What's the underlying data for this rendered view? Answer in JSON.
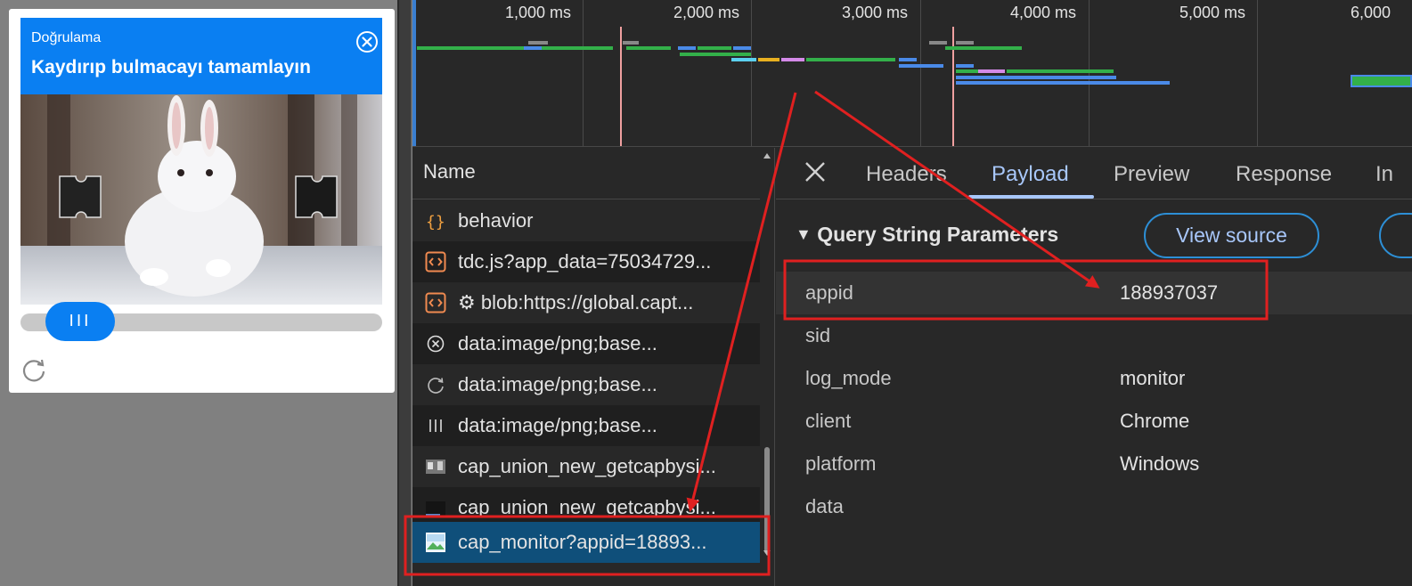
{
  "captcha": {
    "small_title": "Doğrulama",
    "title": "Kaydırıp bulmacayı tamamlayın",
    "slider_handle_glyph": "III",
    "colors": {
      "accent": "#0a7ff2"
    }
  },
  "timeline": {
    "ticks": [
      "1,000 ms",
      "2,000 ms",
      "3,000 ms",
      "4,000 ms",
      "5,000 ms",
      "6,000"
    ]
  },
  "network": {
    "column_header": "Name",
    "requests": [
      {
        "label": "behavior",
        "icon": "json-braces-icon"
      },
      {
        "label": "tdc.js?app_data=75034729...",
        "icon": "script-icon"
      },
      {
        "label": "⚙ blob:https://global.capt...",
        "icon": "script-icon"
      },
      {
        "label": "data:image/png;base...",
        "icon": "circle-x-icon"
      },
      {
        "label": "data:image/png;base...",
        "icon": "refresh-arc-icon"
      },
      {
        "label": "data:image/png;base...",
        "icon": "three-bars-icon"
      },
      {
        "label": "cap_union_new_getcapbysi...",
        "icon": "image-thumbnail-icon"
      },
      {
        "label": "cap_union_new_getcapbysi...",
        "icon": "image-thumbnail-dark-icon"
      },
      {
        "label": "cap_monitor?appid=18893...",
        "icon": "image-file-icon",
        "selected": true
      }
    ]
  },
  "details": {
    "tabs": [
      "Headers",
      "Payload",
      "Preview",
      "Response",
      "In"
    ],
    "active_tab": "Payload",
    "section_title": "Query String Parameters",
    "view_source_label": "View source",
    "params": [
      {
        "key": "appid",
        "value": "188937037"
      },
      {
        "key": "sid",
        "value": ""
      },
      {
        "key": "log_mode",
        "value": "monitor"
      },
      {
        "key": "client",
        "value": "Chrome"
      },
      {
        "key": "platform",
        "value": "Windows"
      },
      {
        "key": "data",
        "value": ""
      }
    ]
  },
  "annotation_color": "#e02020"
}
